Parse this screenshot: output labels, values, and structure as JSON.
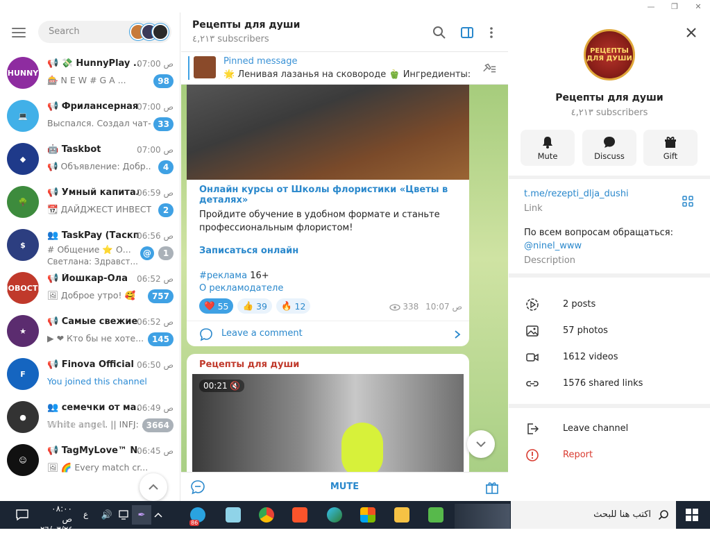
{
  "window": {
    "minimize": "—",
    "maximize": "❐",
    "close": "✕"
  },
  "search": {
    "placeholder": "Search"
  },
  "chats": [
    {
      "title": "📢 💸 HunnyPlay ...",
      "time": "07:00 ص",
      "preview": "🎰 N E W # G A ...",
      "badge": "98",
      "avatar_color": "#8e2ca0",
      "avatar_text": "HUNNY",
      "badge_style": "blue"
    },
    {
      "title": "📢 Фрилансерная",
      "time": "07:00 ص",
      "preview": "Выспался. Создал чат-б...",
      "badge": "33",
      "avatar_color": "#41b0e8",
      "avatar_text": "💻",
      "badge_style": "blue"
    },
    {
      "title": "🤖 Taskbot",
      "time": "07:00 ص",
      "preview": "📢 Объявление: Добр...",
      "badge": "4",
      "avatar_color": "#1f3a8a",
      "avatar_text": "◆",
      "badge_style": "blue"
    },
    {
      "title": "📢 Умный капитал",
      "time": "06:59 ص",
      "preview": "📆 ДАЙДЖЕСТ ИНВЕСТ...",
      "badge": "2",
      "avatar_color": "#3d8b3d",
      "avatar_text": "🌳",
      "badge_style": "blue"
    },
    {
      "title": "👥 TaskPay (Таскп...",
      "time": "06:56 ص",
      "preview": "# Общение ⭐ О...",
      "preview2": "Светлана: Здравст...",
      "badge": "1",
      "avatar_color": "#2c3e80",
      "avatar_text": "$",
      "badge_style": "grey",
      "mention": "@"
    },
    {
      "title": "📢 Йошкар-Ола",
      "time": "06:52 ص",
      "preview": "🖼 Доброе утро! 🥰",
      "badge": "757",
      "avatar_color": "#c0392b",
      "avatar_text": "НОВОСТИ",
      "badge_style": "blue"
    },
    {
      "title": "📢 Самые свежие ...",
      "time": "06:52 ص",
      "preview": "▶ ❤ Кто бы не хоте...",
      "badge": "145",
      "avatar_color": "#5b2c6f",
      "avatar_text": "★",
      "badge_style": "blue"
    },
    {
      "title": "📢 Finova Official",
      "time": "06:50 ص",
      "preview": "You joined this channel",
      "badge": "",
      "avatar_color": "#1565c0",
      "avatar_text": "F",
      "badge_style": "none"
    },
    {
      "title": "👥 семечки от ма...",
      "time": "06:49 ص",
      "preview": "𝕎𝕙𝕚𝕥𝕖 𝕒𝕟𝕘𝕖𝕝. || INFJ: ...",
      "badge": "3664",
      "avatar_color": "#333",
      "avatar_text": "●",
      "badge_style": "grey"
    },
    {
      "title": "📢 TagMyLove™ N...",
      "time": "06:45 ص",
      "preview": "🖼 🌈 Every match cr...",
      "badge": "",
      "avatar_color": "#111",
      "avatar_text": "☺",
      "badge_style": "none"
    }
  ],
  "channel": {
    "title": "Рецепты для души",
    "subscribers": "٤,٢١٣ subscribers",
    "pinned_label": "Pinned message",
    "pinned_text": "🌟 Ленивая лазанья на сковороде 🫑 Ингредиенты: ..."
  },
  "post1": {
    "link_title": "Онлайн курсы от Школы флористики «Цветы в деталях»",
    "body": "Пройдите обучение в удобном формате и станьте профессиональным флористом!",
    "signup": "Записаться онлайн",
    "hashtag": "#реклама",
    "age": "16+",
    "about": "О рекламодателе",
    "reactions": [
      {
        "emoji": "❤️",
        "count": "55",
        "selected": true
      },
      {
        "emoji": "👍",
        "count": "39",
        "selected": false
      },
      {
        "emoji": "🔥",
        "count": "12",
        "selected": false
      }
    ],
    "views": "338",
    "time": "10:07 ص",
    "comment_label": "Leave a comment"
  },
  "post2": {
    "author": "Рецепты для души",
    "duration": "00:21"
  },
  "footer": {
    "mute": "MUTE"
  },
  "profile": {
    "logo_text": "РЕЦЕПТЫ ДЛЯ ДУШИ",
    "name": "Рецепты для души",
    "subscribers": "٤,٢١٣ subscribers",
    "actions": [
      {
        "label": "Mute",
        "icon": "bell-icon"
      },
      {
        "label": "Discuss",
        "icon": "chat-bubble-icon"
      },
      {
        "label": "Gift",
        "icon": "gift-icon"
      }
    ],
    "link": "t.me/rezepti_dlja_dushi",
    "link_caption": "Link",
    "description_line": "По всем вопросам обращаться:",
    "description_handle": "@ninel_www",
    "description_caption": "Description",
    "media": [
      {
        "label": "2 posts",
        "icon": "posts-icon"
      },
      {
        "label": "57 photos",
        "icon": "photo-icon"
      },
      {
        "label": "1612 videos",
        "icon": "video-icon"
      },
      {
        "label": "1576 shared links",
        "icon": "link-icon"
      }
    ],
    "leave": "Leave channel",
    "report": "Report"
  },
  "taskbar": {
    "time": "٠٨:٠٠ ص",
    "date": "٢٦/٠٣/٢٤",
    "lang": "ع",
    "search": "اكتب هنا للبحث",
    "telegram_badge": "86"
  },
  "colors": {
    "accent": "#3fa1e4",
    "report": "#d93b30",
    "taskbar": "#1b2533"
  }
}
